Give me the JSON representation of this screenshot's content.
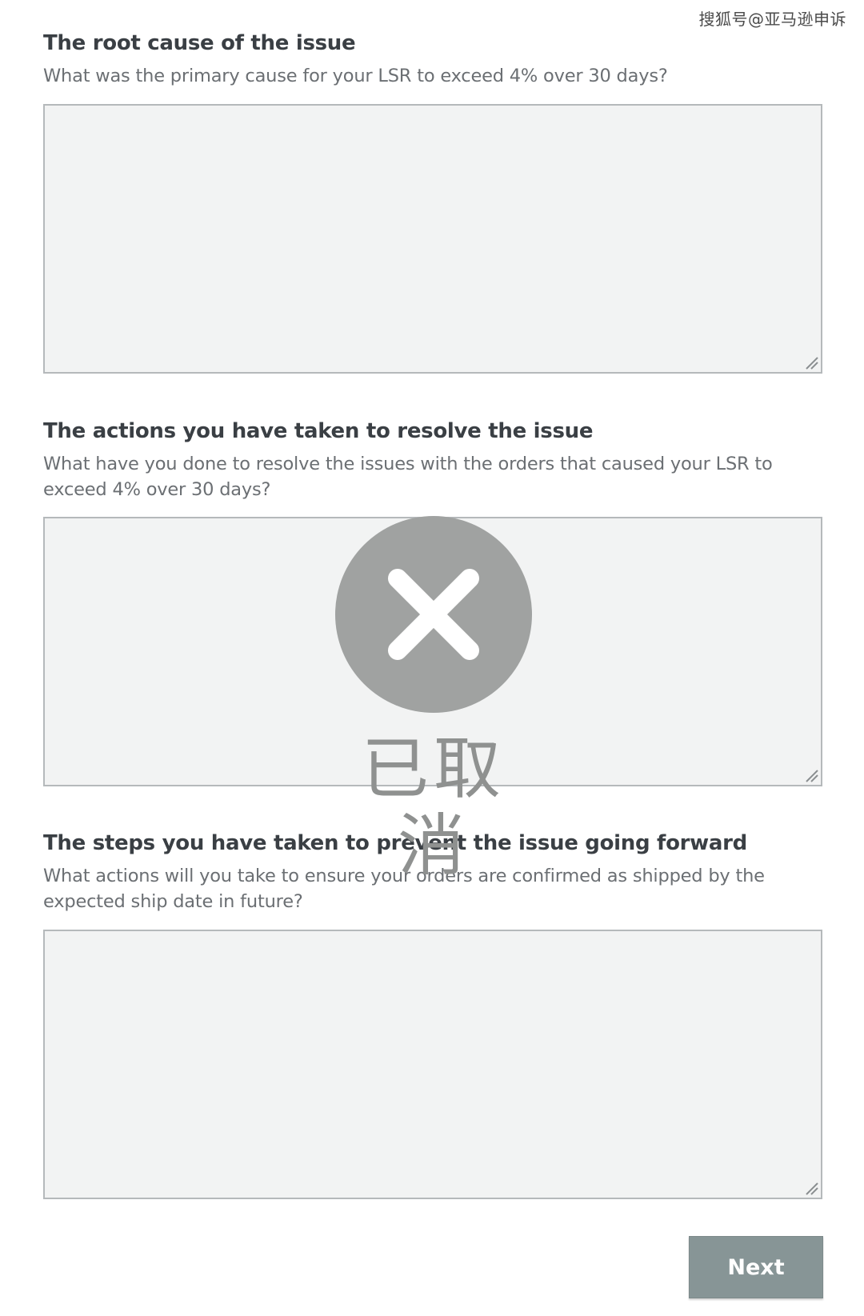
{
  "watermark": "搜狐号@亚马逊申诉",
  "sections": [
    {
      "title": "The root cause of the issue",
      "hint": "What was the primary cause for your LSR to exceed 4% over 30 days?"
    },
    {
      "title": "The actions you have taken to resolve the issue",
      "hint": "What have you done to resolve the issues with the orders that caused your LSR to exceed 4% over 30 days?"
    },
    {
      "title": "The steps you have taken to prevent the issue going forward",
      "hint": "What actions will you take to ensure your orders are confirmed as shipped by the expected ship date in future?"
    }
  ],
  "next_label": "Next",
  "overlay": {
    "icon": "close-icon",
    "status_text": "已取消"
  },
  "colors": {
    "button_bg": "#879596",
    "textarea_bg": "#f2f3f3",
    "overlay_circle": "#a0a2a1"
  }
}
